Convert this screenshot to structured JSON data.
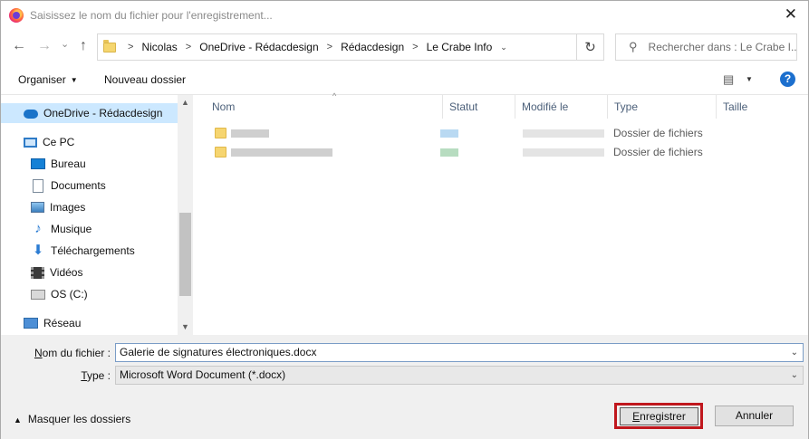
{
  "titlebar": {
    "title": "Saisissez le nom du fichier pour l'enregistrement...",
    "close_glyph": "✕",
    "app_icon": "firefox-icon"
  },
  "nav": {
    "back_glyph": "←",
    "forward_glyph": "→",
    "dropdown_glyph": "⌄",
    "up_glyph": "↑",
    "refresh_glyph": "↻"
  },
  "address": {
    "sep": ">",
    "crumbs": [
      "Nicolas",
      "OneDrive - Rédacdesign",
      "Rédacdesign",
      "Le Crabe Info"
    ]
  },
  "search": {
    "glyph": "⚲",
    "placeholder": "Rechercher dans : Le Crabe I..."
  },
  "toolbar": {
    "organize": "Organiser",
    "organize_caret": "▼",
    "new_folder": "Nouveau dossier",
    "view_glyph": "▤",
    "view_caret": "▼",
    "help": "?"
  },
  "sidebar": {
    "items": [
      {
        "label": "OneDrive - Rédacdesign",
        "icon": "cloud-icon"
      },
      {
        "label": "Ce PC",
        "icon": "pc-icon"
      },
      {
        "label": "Bureau",
        "icon": "desktop-icon"
      },
      {
        "label": "Documents",
        "icon": "documents-icon"
      },
      {
        "label": "Images",
        "icon": "images-icon"
      },
      {
        "label": "Musique",
        "icon": "music-icon"
      },
      {
        "label": "Téléchargements",
        "icon": "downloads-icon"
      },
      {
        "label": "Vidéos",
        "icon": "videos-icon"
      },
      {
        "label": "OS (C:)",
        "icon": "disk-icon"
      },
      {
        "label": "Réseau",
        "icon": "network-icon"
      }
    ],
    "music_glyph": "♪",
    "download_glyph": "⬇",
    "scroll_up": "▲",
    "scroll_down": "▼"
  },
  "filelist": {
    "columns": [
      "Nom",
      "Statut",
      "Modifié le",
      "Type",
      "Taille"
    ],
    "sort_glyph": "^",
    "rows": [
      {
        "type": "Dossier de fichiers"
      },
      {
        "type": "Dossier de fichiers"
      }
    ]
  },
  "form": {
    "filename_label_u": "N",
    "filename_label_rest": "om du fichier :",
    "filename_value": "Galerie de signatures électroniques.docx",
    "type_label_u": "T",
    "type_label_rest": "ype :",
    "type_value": "Microsoft Word Document (*.docx)",
    "caret": "⌄",
    "hide_folders_caret": "▲",
    "hide_folders": "Masquer les dossiers",
    "save_u": "E",
    "save_rest": "nregistrer",
    "cancel": "Annuler"
  },
  "colors": {
    "selected_bg": "#cce8ff",
    "highlight_ring": "#c0171d",
    "help_blue": "#1c6fce"
  }
}
